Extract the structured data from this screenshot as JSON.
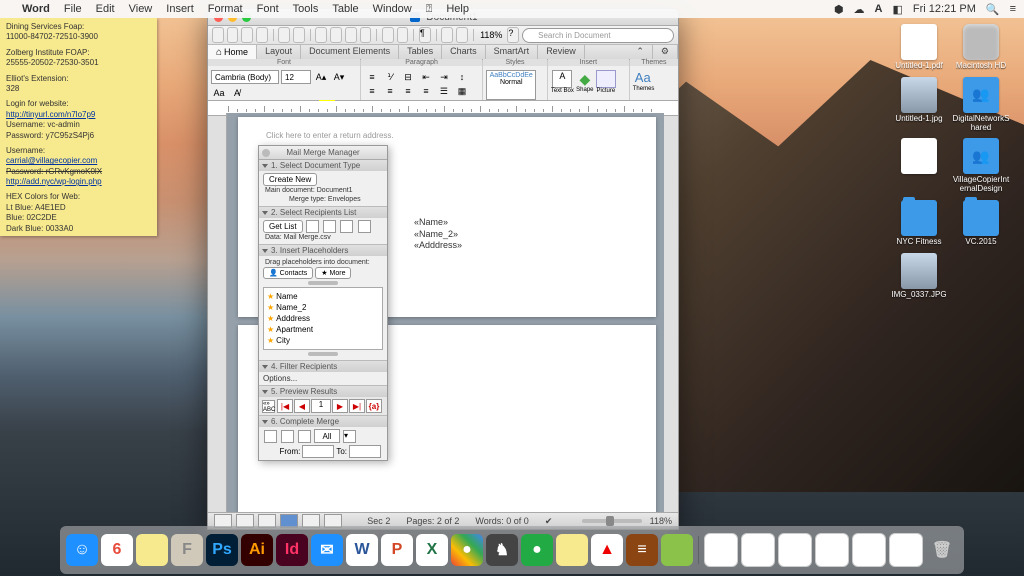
{
  "menubar": {
    "app": "Word",
    "items": [
      "File",
      "Edit",
      "View",
      "Insert",
      "Format",
      "Font",
      "Tools",
      "Table",
      "Window",
      "Help"
    ],
    "right": {
      "time": "Fri 12:21 PM",
      "icons": [
        "db",
        "cc",
        "bt",
        "A",
        "flag",
        "clock"
      ]
    }
  },
  "sticky": {
    "l1": "Dining Services Foap:",
    "l2": "11000-84702-72510-3900",
    "l3": "Zolberg Institute FOAP:",
    "l4": "25555-20502-72530-3501",
    "l5": "Elliot's Extension:",
    "l6": "328",
    "l7": "Login for website:",
    "l8": "http://tinyurl.com/n7lo7p9",
    "l9": "Username: vc-admin",
    "l10": "Password: y7C95zS4Pj6",
    "l11": "Username:",
    "l12": "carrial@villagecopier.com",
    "l13": "Password: rGRvKgmoK0lX",
    "l14": "http://add.nyc/wp-login.php",
    "l15": "HEX Colors for Web:",
    "l16": "Lt Blue: A4E1ED",
    "l17": "Blue: 02C2DE",
    "l18": "Dark Blue: 0033A0"
  },
  "desktop_icons": [
    {
      "label": "Untitled-1.pdf",
      "type": "pdf"
    },
    {
      "label": "Macintosh HD",
      "type": "hd"
    },
    {
      "label": "Untitled-1.jpg",
      "type": "jpg"
    },
    {
      "label": "DigitalNetworkShared",
      "type": "people"
    },
    {
      "label": "",
      "type": "pdf"
    },
    {
      "label": "VillageCopierInternalDesign",
      "type": "people"
    },
    {
      "label": "NYC Fitness",
      "type": "folder"
    },
    {
      "label": "VC.2015",
      "type": "folder"
    },
    {
      "label": "IMG_0337.JPG",
      "type": "jpg"
    }
  ],
  "word": {
    "title": "Document1",
    "search_placeholder": "Search in Document",
    "zoom": "118%",
    "tabs": [
      "Home",
      "Layout",
      "Document Elements",
      "Tables",
      "Charts",
      "SmartArt",
      "Review"
    ],
    "font": {
      "name": "Cambria (Body)",
      "size": "12"
    },
    "ribbon_groups": {
      "font": "Font",
      "para": "Paragraph",
      "styles": "Styles",
      "insert": "Insert",
      "themes": "Themes"
    },
    "style_preview": "AaBbCcDdEe",
    "style_name": "Normal",
    "insert": {
      "textbox": "Text Box",
      "shape": "Shape",
      "picture": "Picture",
      "themes": "Themes"
    },
    "page": {
      "return": "Click here to enter a return address.",
      "fields": [
        "«Name»",
        "«Name_2»",
        "«Adddress»"
      ]
    },
    "status": {
      "sec": "Sec",
      "sec_v": "2",
      "pages": "Pages:",
      "pages_v": "2 of 2",
      "words": "Words:",
      "words_v": "0 of 0",
      "zoom": "118%"
    }
  },
  "mailmerge": {
    "title": "Mail Merge Manager",
    "s1": {
      "hdr": "1. Select Document Type",
      "btn": "Create New",
      "info1": "Main document: Document1",
      "info2": "Merge type: Envelopes"
    },
    "s2": {
      "hdr": "2. Select Recipients List",
      "btn": "Get List",
      "data": "Data: Mail Merge.csv"
    },
    "s3": {
      "hdr": "3. Insert Placeholders",
      "drag": "Drag placeholders into document:",
      "contacts": "Contacts",
      "more": "More",
      "fields": [
        "Name",
        "Name_2",
        "Adddress",
        "Apartment",
        "City"
      ]
    },
    "s4": {
      "hdr": "4. Filter Recipients",
      "opt": "Options..."
    },
    "s5": {
      "hdr": "5. Preview Results",
      "rec": "1",
      "abc": "{a}"
    },
    "s6": {
      "hdr": "6. Complete Merge",
      "all": "All",
      "from": "From:",
      "to": "To:"
    }
  },
  "dock": [
    {
      "name": "finder",
      "bg": "#1e90ff",
      "txt": "☺"
    },
    {
      "name": "calendar",
      "bg": "#fff",
      "txt": "6",
      "color": "#e74c3c"
    },
    {
      "name": "notes",
      "bg": "#f7e98e",
      "txt": ""
    },
    {
      "name": "font",
      "bg": "#d0c8b8",
      "txt": "F",
      "color": "#888"
    },
    {
      "name": "photoshop",
      "bg": "#001e36",
      "txt": "Ps",
      "color": "#31a8ff"
    },
    {
      "name": "illustrator",
      "bg": "#330000",
      "txt": "Ai",
      "color": "#ff9a00"
    },
    {
      "name": "indesign",
      "bg": "#49021f",
      "txt": "Id",
      "color": "#ff3366"
    },
    {
      "name": "mail",
      "bg": "#1e90ff",
      "txt": "✉"
    },
    {
      "name": "word",
      "bg": "#fff",
      "txt": "W",
      "color": "#2b579a"
    },
    {
      "name": "powerpoint",
      "bg": "#fff",
      "txt": "P",
      "color": "#d24726"
    },
    {
      "name": "excel",
      "bg": "#fff",
      "txt": "X",
      "color": "#217346"
    },
    {
      "name": "chrome",
      "bg": "linear-gradient(45deg,#ea4335,#fbbc05,#34a853,#4285f4)",
      "txt": "●"
    },
    {
      "name": "app1",
      "bg": "#444",
      "txt": "♞"
    },
    {
      "name": "app2",
      "bg": "#2a4",
      "txt": "●"
    },
    {
      "name": "stickies",
      "bg": "#f7e98e",
      "txt": ""
    },
    {
      "name": "adobe",
      "bg": "#fff",
      "txt": "▲",
      "color": "#e00"
    },
    {
      "name": "books",
      "bg": "#8b4513",
      "txt": "≡"
    },
    {
      "name": "app3",
      "bg": "#8bc34a",
      "txt": ""
    },
    {
      "name": "sep",
      "sep": true
    },
    {
      "name": "doc1",
      "bg": "#fff",
      "txt": "",
      "color": "#999"
    },
    {
      "name": "doc2",
      "bg": "#fff",
      "txt": "",
      "color": "#999"
    },
    {
      "name": "doc3",
      "bg": "#fff",
      "txt": "",
      "color": "#999"
    },
    {
      "name": "doc4",
      "bg": "#fff",
      "txt": "",
      "color": "#999"
    },
    {
      "name": "doc5",
      "bg": "#fff",
      "txt": "",
      "color": "#999"
    },
    {
      "name": "doc6",
      "bg": "#fff",
      "txt": "",
      "color": "#999"
    },
    {
      "name": "trash",
      "bg": "transparent",
      "txt": "🗑",
      "color": "#ccc"
    }
  ]
}
